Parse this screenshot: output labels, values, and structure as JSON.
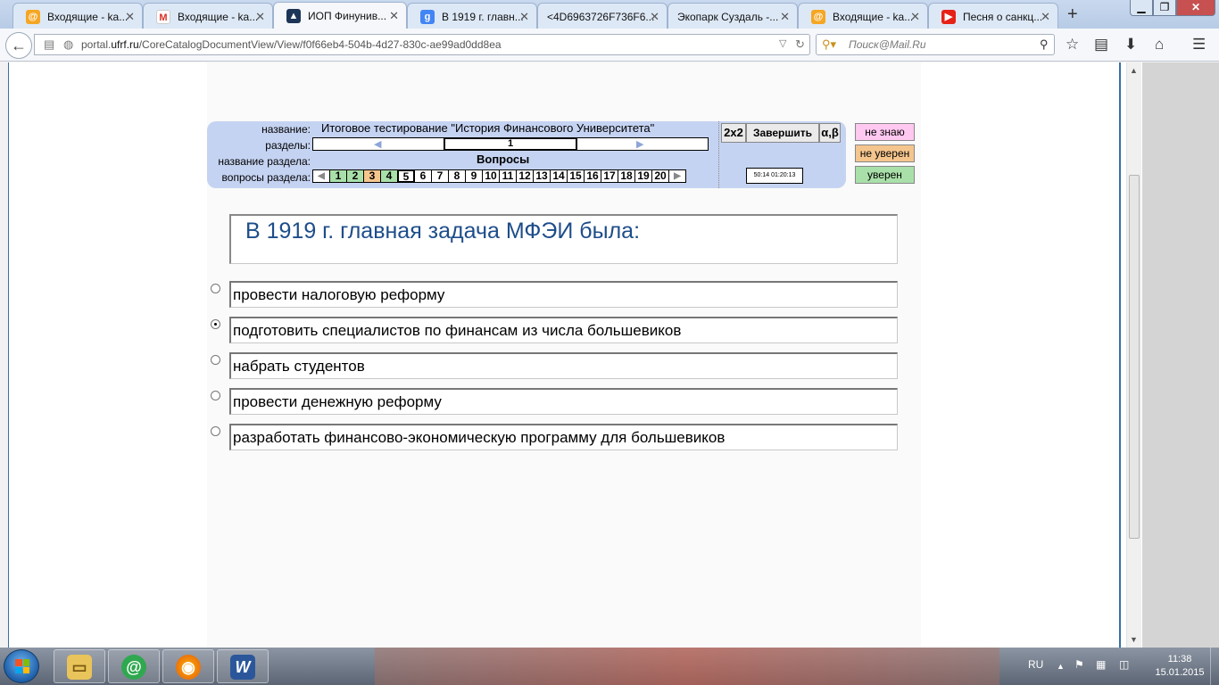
{
  "browser": {
    "tabs": [
      {
        "label": "Входящие - ka...",
        "icon": "mail-ru-icon"
      },
      {
        "label": "Входящие - ka...",
        "icon": "gmail-icon"
      },
      {
        "label": "ИОП Финунив...",
        "icon": "graduation-cap-icon",
        "active": true
      },
      {
        "label": "В 1919 г. главн...",
        "icon": "google-icon"
      },
      {
        "label": "<4D6963726F736F6...",
        "icon": "blank-page-icon"
      },
      {
        "label": "Экопарк Суздаль -...",
        "icon": "blank-page-icon"
      },
      {
        "label": "Входящие - ka...",
        "icon": "mail-ru-icon"
      },
      {
        "label": "Песня о санкц...",
        "icon": "youtube-icon"
      }
    ],
    "url_prefix": "portal.",
    "url_domain": "ufrf.ru",
    "url_path": "/CoreCatalogDocumentView/View/f0f66eb4-504b-4d27-830c-ae99ad0dd8ea",
    "search_placeholder": "Поиск@Mail.Ru"
  },
  "test": {
    "labels": {
      "name": "название:",
      "sections": "разделы:",
      "section_name": "название раздела:",
      "section_questions": "вопросы раздела:"
    },
    "title": "Итоговое тестирование \"История Финансового Университета\"",
    "current_section": "1",
    "section_name": "Вопросы",
    "questions": [
      {
        "n": "1",
        "state": "green"
      },
      {
        "n": "2",
        "state": "green"
      },
      {
        "n": "3",
        "state": "orange"
      },
      {
        "n": "4",
        "state": "green"
      },
      {
        "n": "5",
        "state": "current"
      },
      {
        "n": "6",
        "state": ""
      },
      {
        "n": "7",
        "state": ""
      },
      {
        "n": "8",
        "state": ""
      },
      {
        "n": "9",
        "state": ""
      },
      {
        "n": "10",
        "state": ""
      },
      {
        "n": "11",
        "state": ""
      },
      {
        "n": "12",
        "state": ""
      },
      {
        "n": "13",
        "state": ""
      },
      {
        "n": "14",
        "state": ""
      },
      {
        "n": "15",
        "state": ""
      },
      {
        "n": "16",
        "state": ""
      },
      {
        "n": "17",
        "state": ""
      },
      {
        "n": "18",
        "state": ""
      },
      {
        "n": "19",
        "state": ""
      },
      {
        "n": "20",
        "state": ""
      }
    ],
    "btn_2x2": "2x2",
    "btn_finish": "Завершить",
    "btn_alpha": "α,β",
    "timer": "50:14  01:20:13",
    "confidence": {
      "unknown": "не знаю",
      "not_sure": "не уверен",
      "sure": "уверен"
    }
  },
  "question": {
    "text": "В 1919 г. главная задача МФЭИ была:",
    "answers": [
      {
        "text": "провести налоговую реформу",
        "selected": false
      },
      {
        "text": "подготовить специалистов по финансам из числа большевиков",
        "selected": true
      },
      {
        "text": "набрать студентов",
        "selected": false
      },
      {
        "text": "провести денежную реформу",
        "selected": false
      },
      {
        "text": "разработать финансово-экономическую программу для большевиков",
        "selected": false
      }
    ]
  },
  "taskbar": {
    "lang": "RU",
    "time": "11:38",
    "date": "15.01.2015",
    "apps": [
      "file-explorer-icon",
      "mail-agent-icon",
      "firefox-icon",
      "word-icon"
    ]
  },
  "colors": {
    "panel": "#c5d3f2",
    "question_text": "#1d4d8a",
    "answered": "#a9e0a9",
    "not_sure": "#f5c58e",
    "unknown": "#ffc8f0"
  }
}
